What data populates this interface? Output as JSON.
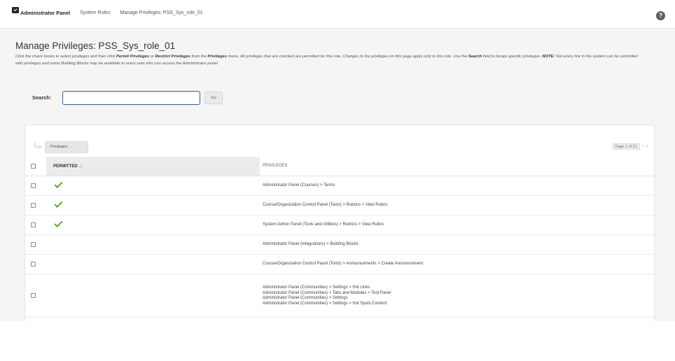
{
  "breadcrumb": {
    "home_label": "Administrator Panel",
    "items": [
      "System Roles",
      "Manage Privileges: PSS_Sys_role_01"
    ]
  },
  "help_label": "?",
  "page": {
    "title": "Manage Privileges: PSS_Sys_role_01",
    "instructions": {
      "t1": "Click the check boxes to select privileges and then click ",
      "b1": "Permit Privileges",
      "t2": " or ",
      "b2": "Restrict Privileges",
      "t3": " from the ",
      "b3": "Privileges",
      "t4": " menu. All privileges that are checked are permitted for this role. Changes to the privileges on this page apply only to this role. Use the ",
      "b4": "Search",
      "t5": " field to locate specific privileges. ",
      "b5": "NOTE:",
      "t6": " Not every link in the system can be controlled with privileges and some Building Blocks may be available to every user who can access the Administrator panel."
    }
  },
  "search": {
    "label": "Search:",
    "value": "",
    "placeholder": "",
    "go_label": "Go"
  },
  "toolbar": {
    "privileges_menu_label": "Privileges:",
    "page_info": "Page 1 of 21"
  },
  "table": {
    "headers": {
      "permitted": "PERMITTED",
      "privileges": "PRIVILEGES"
    },
    "rows": [
      {
        "permitted": true,
        "privileges": [
          "Administrator Panel (Courses) > Terms"
        ]
      },
      {
        "permitted": true,
        "privileges": [
          "Course/Organization Control Panel (Tools) > Rubrics > View Rubric"
        ]
      },
      {
        "permitted": true,
        "privileges": [
          "System Admin Panel (Tools and Utilities) > Rubrics > View Rubric"
        ]
      },
      {
        "permitted": false,
        "privileges": [
          "Administrator Panel (Integrations) > Building Blocks"
        ]
      },
      {
        "permitted": false,
        "privileges": [
          "Course/Organization Control Panel (Tools) > Announcements > Create Announcement"
        ]
      },
      {
        "permitted": false,
        "privileges": [
          "Administrator Panel (Communities) > Settings > Hot Links",
          "Administrator Panel (Communities) > Tabs and Modules > Tool Panel",
          "Administrator Panel (Communities) > Settings",
          "Administrator Panel (Communities) > Settings > Hot Spots Content"
        ]
      }
    ]
  },
  "colors": {
    "accent_check": "#5ea62e",
    "search_border": "#2f5e8f",
    "sort_arrow": "#e0a100"
  },
  "icons": {
    "crumb": "admin-panel-icon",
    "help": "help-icon",
    "toolbar_arrow": "select-arrow-icon",
    "permitted_mark": "checkmark-icon",
    "sort": "sort-ascending-icon"
  }
}
